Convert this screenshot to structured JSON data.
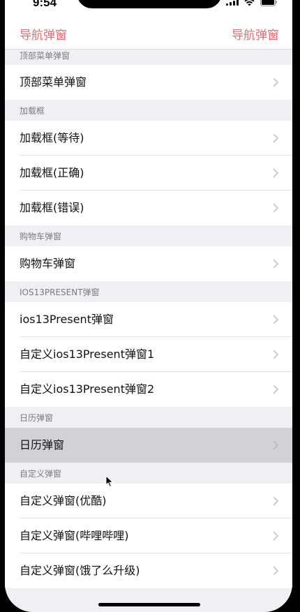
{
  "status_bar": {
    "time": "9:54"
  },
  "nav": {
    "left_title": "导航弹窗",
    "right_title": "导航弹窗"
  },
  "sections": [
    {
      "header": "顶部菜单弹窗",
      "rows": [
        "顶部菜单弹窗"
      ]
    },
    {
      "header": "加载框",
      "rows": [
        "加载框(等待)",
        "加载框(正确)",
        "加载框(错误)"
      ]
    },
    {
      "header": "购物车弹窗",
      "rows": [
        "购物车弹窗"
      ]
    },
    {
      "header": "IOS13PRESENT弹窗",
      "rows": [
        "ios13Present弹窗",
        "自定义ios13Present弹窗1",
        "自定义ios13Present弹窗2"
      ]
    },
    {
      "header": "日历弹窗",
      "rows": [
        "日历弹窗"
      ]
    },
    {
      "header": "自定义弹窗",
      "rows": [
        "自定义弹窗(优酷)",
        "自定义弹窗(哔哩哔哩)",
        "自定义弹窗(饿了么升级)"
      ]
    }
  ],
  "selected_row": "日历弹窗",
  "colors": {
    "nav_accent": "#e86a75",
    "selected_row": "#d1d1d6",
    "section_bg": "#efeff4"
  },
  "icons": {
    "row_accessory": "chevron-right-icon",
    "pointer": "cursor-arrow-icon"
  }
}
